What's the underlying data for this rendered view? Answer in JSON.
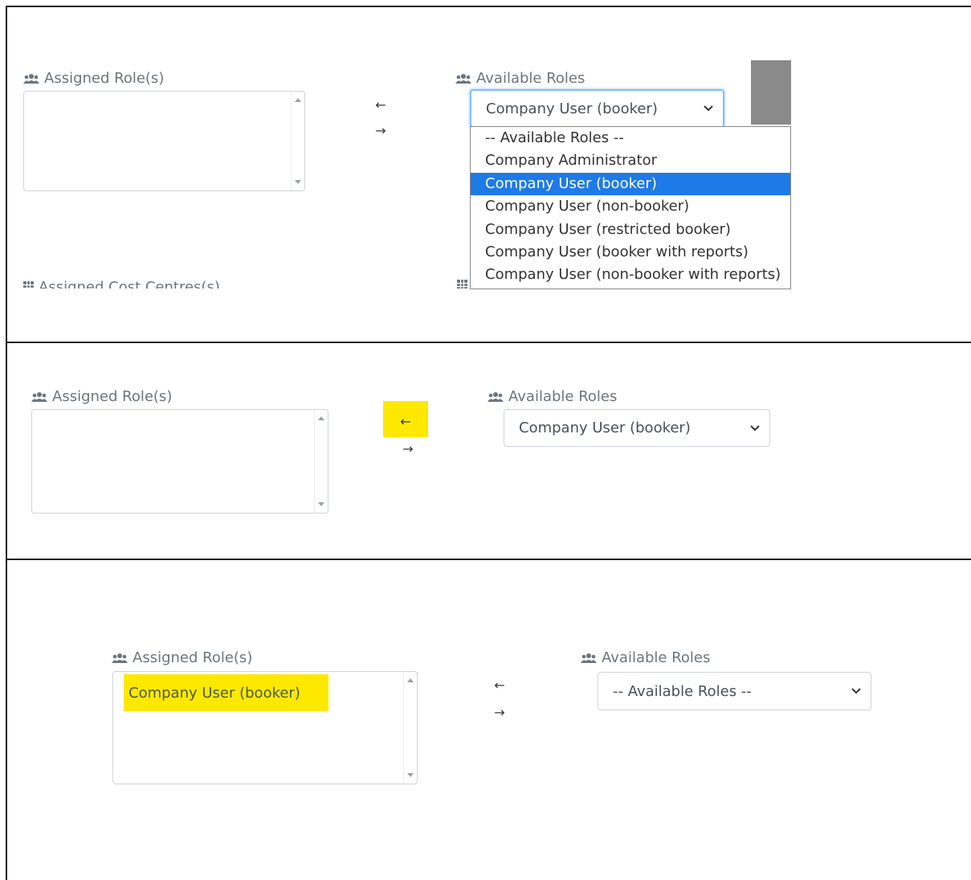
{
  "icons": {
    "users": "users-icon",
    "grid": "table-grid-icon",
    "chevron": "chevron-down-icon"
  },
  "colors": {
    "highlight": "#ffe800",
    "dropdown_selected": "#1e7ae6",
    "focus_border": "#80bdff"
  },
  "panel1": {
    "assigned_label": "Assigned Role(s)",
    "available_label": "Available Roles",
    "select_value": "Company User (booker)",
    "move_left": "←",
    "move_right": "→",
    "assigned_cost_centres_label": "Assigned Cost Centres(s)",
    "dropdown_options": [
      "-- Available Roles --",
      "Company Administrator",
      "Company User (booker)",
      "Company User (non-booker)",
      "Company User (restricted booker)",
      "Company User (booker with reports)",
      "Company User (non-booker with reports)"
    ],
    "selected_option": "Company User (booker)"
  },
  "panel2": {
    "assigned_label": "Assigned Role(s)",
    "available_label": "Available Roles",
    "select_value": "Company User (booker)",
    "move_left": "←",
    "move_right": "→"
  },
  "panel3": {
    "assigned_label": "Assigned Role(s)",
    "available_label": "Available Roles",
    "select_value": "-- Available Roles --",
    "assigned_items": [
      "Company User (booker)"
    ],
    "move_left": "←",
    "move_right": "→"
  }
}
